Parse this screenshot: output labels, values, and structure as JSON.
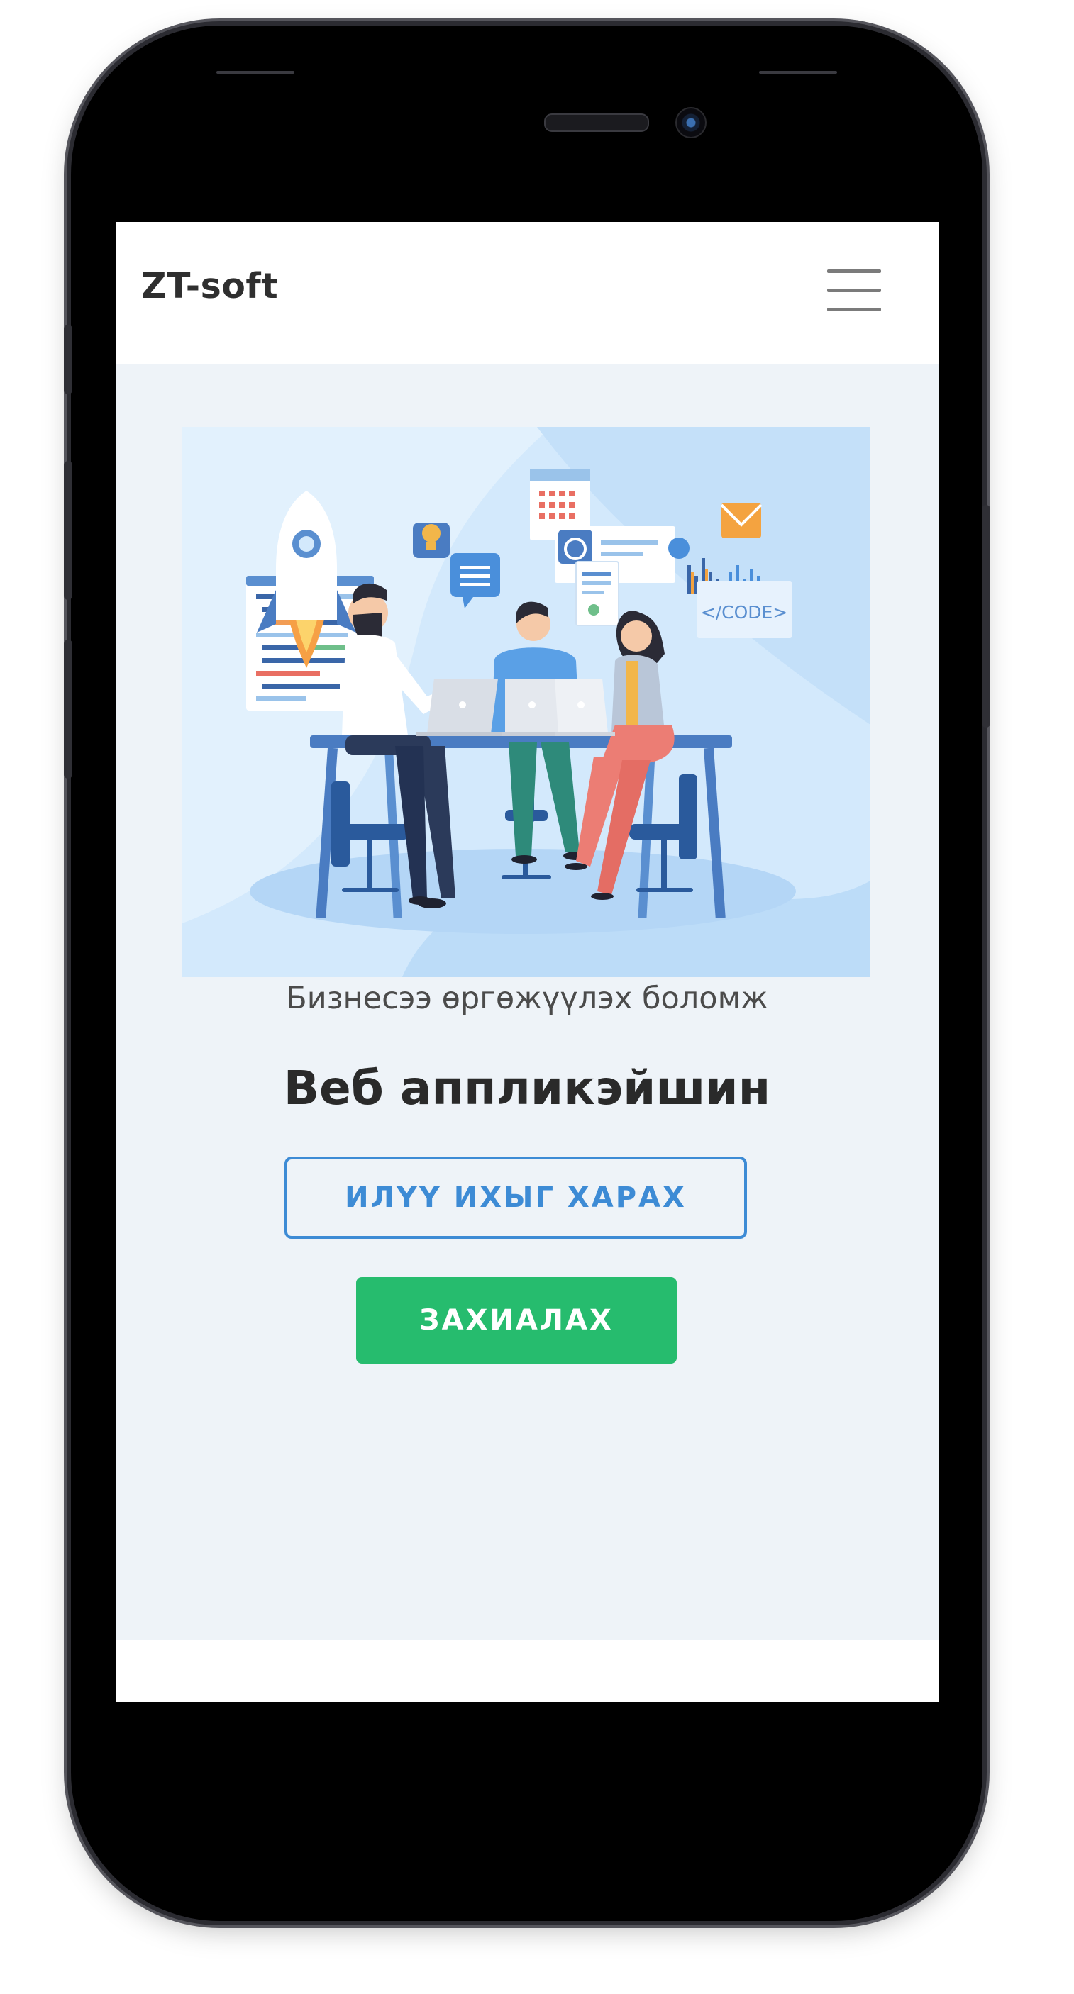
{
  "navbar": {
    "brand": "ZT-soft",
    "menu_icon": "hamburger-menu-icon"
  },
  "hero": {
    "illustration": "team-working-at-desk-illustration",
    "code_tag": "</CODE>",
    "subtitle": "Бизнесээ өргөжүүлэх боломж",
    "title": "Веб аппликэйшин",
    "more_button_label": "ИЛҮҮ ИХЫГ ХАРАХ",
    "order_button_label": "ЗАХИАЛАХ"
  },
  "colors": {
    "accent_blue": "#3d8bd5",
    "order_green": "#26bc6e",
    "hero_background": "#eef3f8"
  }
}
